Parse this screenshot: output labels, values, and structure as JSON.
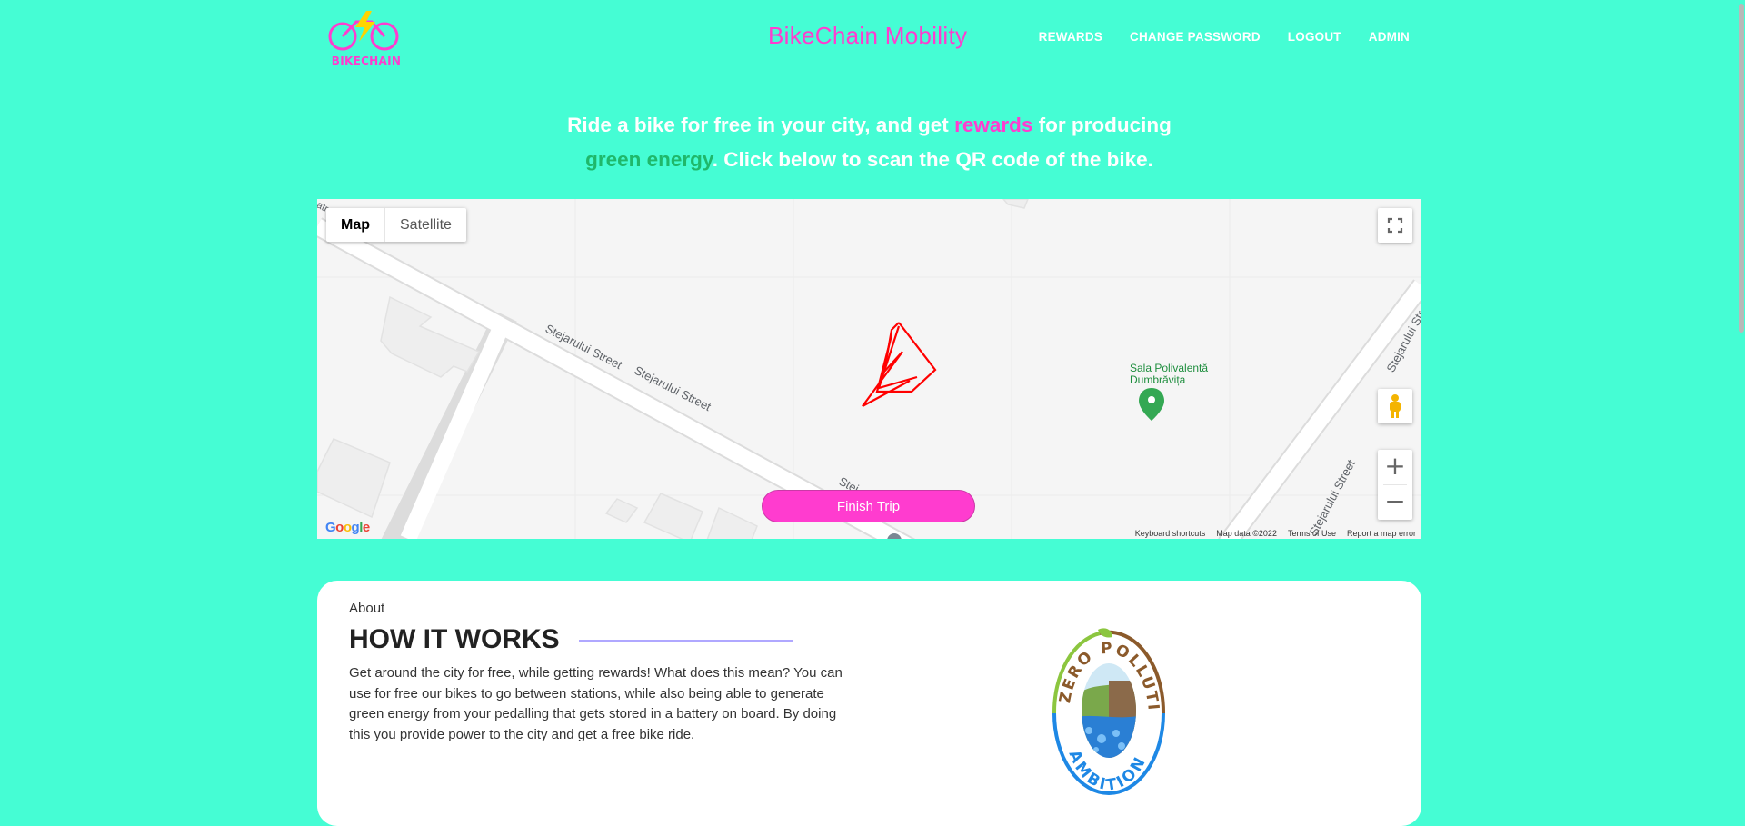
{
  "header": {
    "logo_text": "BIKECHAIN",
    "brand_title": "BikeChain Mobility",
    "nav": [
      {
        "label": "REWARDS"
      },
      {
        "label": "CHANGE PASSWORD"
      },
      {
        "label": "LOGOUT"
      },
      {
        "label": "ADMIN"
      }
    ]
  },
  "hero": {
    "part1": "Ride a bike for free in your city, and get ",
    "highlight1": "rewards",
    "part2": " for producing",
    "highlight2": "green energy",
    "part3": ". Click below to scan the QR code of the bike."
  },
  "map": {
    "type_map": "Map",
    "type_satellite": "Satellite",
    "streets": {
      "s1": "Stejarului Street",
      "s2": "Stejarului Street",
      "s3": "Stej",
      "s4": "Stejarului Stre",
      "s5": "Stejarului Street",
      "s6": "atr"
    },
    "poi": "Sala Polivalentă Dumbrăvița",
    "google": "Google",
    "attribution": [
      "Keyboard shortcuts",
      "Map data ©2022",
      "Terms of Use",
      "Report a map error"
    ],
    "finish_button": "Finish Trip"
  },
  "about": {
    "label": "About",
    "title": "HOW IT WORKS",
    "description": "Get around the city for free, while getting rewards! What does this mean? You can use for free our bikes to go between stations, while also being able to generate green energy from your pedalling that gets stored in a battery on board. By doing this you provide power to the city and get a free bike ride.",
    "badge_top": "ZERO POLLUTION",
    "badge_bottom": "AMBITION"
  },
  "colors": {
    "background": "#45fdd4",
    "accent_pink": "#ff3ccf",
    "accent_green": "#1fb86a",
    "route": "#ff0000"
  }
}
